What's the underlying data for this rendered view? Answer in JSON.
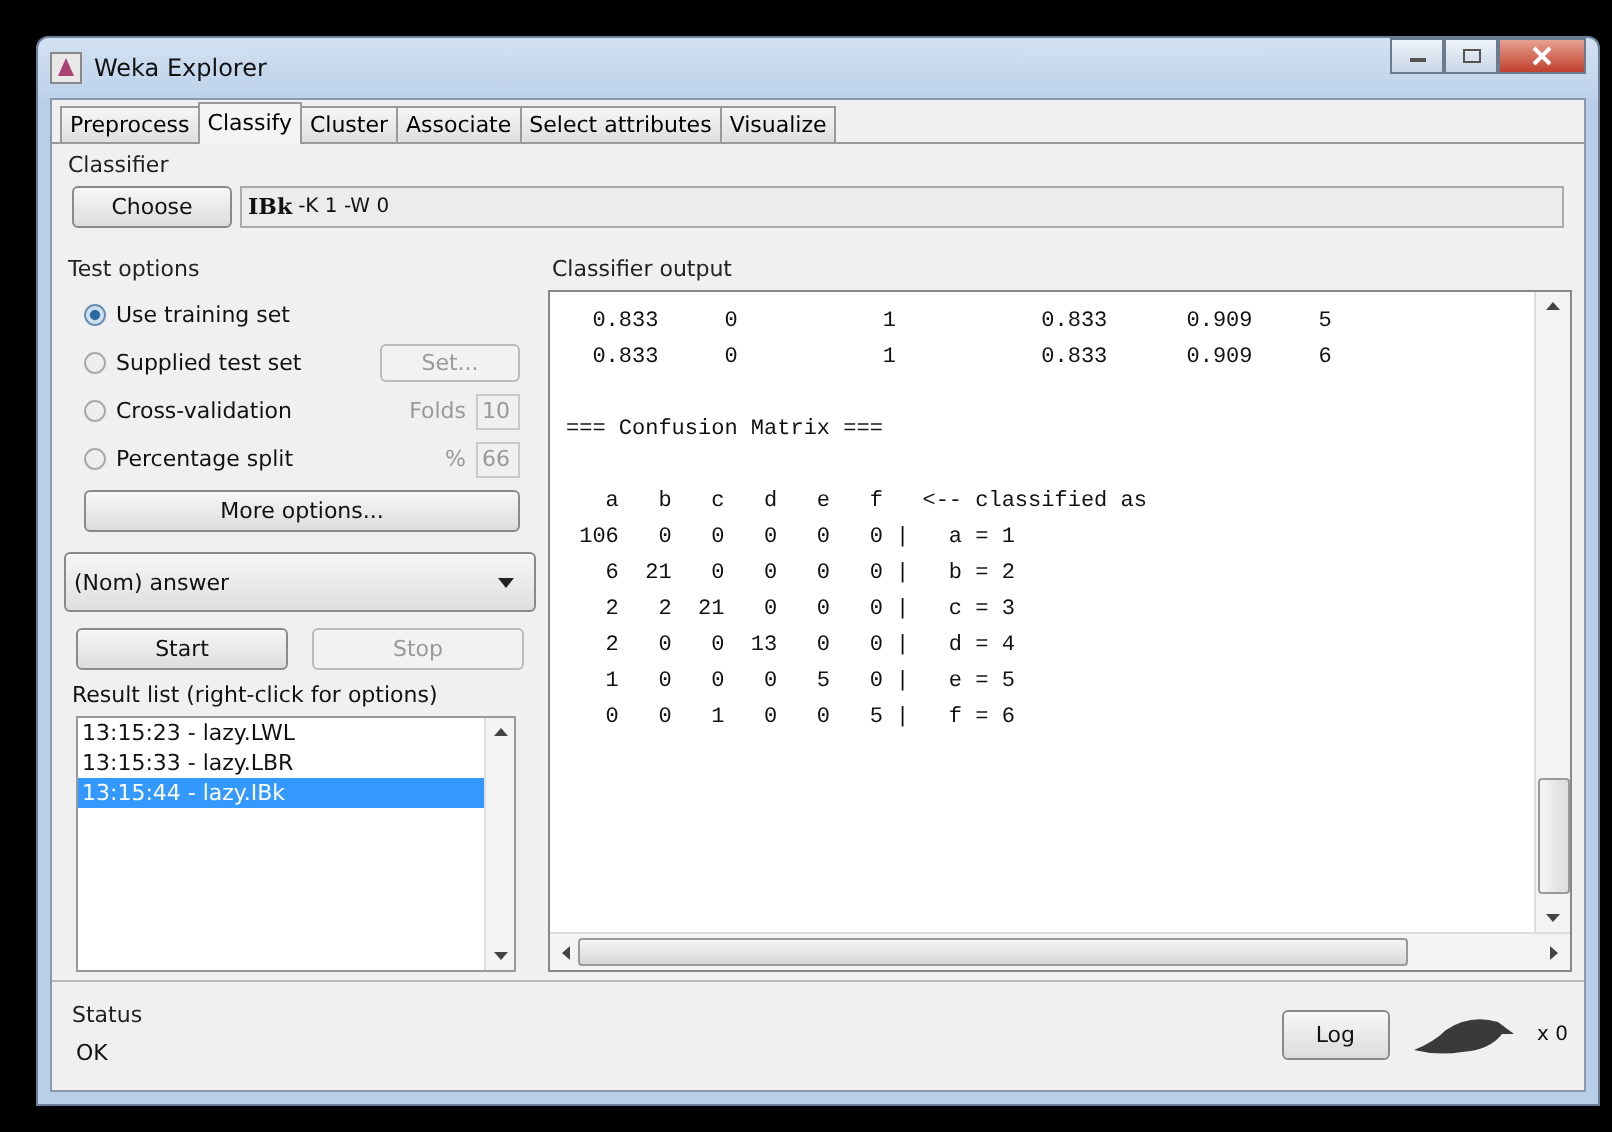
{
  "window": {
    "title": "Weka Explorer"
  },
  "tabs": [
    {
      "label": "Preprocess",
      "selected": false
    },
    {
      "label": "Classify",
      "selected": true
    },
    {
      "label": "Cluster",
      "selected": false
    },
    {
      "label": "Associate",
      "selected": false
    },
    {
      "label": "Select attributes",
      "selected": false
    },
    {
      "label": "Visualize",
      "selected": false
    }
  ],
  "classifier": {
    "title": "Classifier",
    "button": "Choose",
    "name": "IBk",
    "options": "-K 1 -W 0"
  },
  "test_options": {
    "title": "Test options",
    "options": [
      {
        "label": "Use training set",
        "selected": true
      },
      {
        "label": "Supplied test set",
        "selected": false,
        "kind": "button",
        "control": "Set...",
        "disabled": true
      },
      {
        "label": "Cross-validation",
        "selected": false,
        "kind": "field",
        "field_label": "Folds",
        "value": "10",
        "disabled": true
      },
      {
        "label": "Percentage split",
        "selected": false,
        "kind": "field",
        "field_label": "%",
        "value": "66",
        "disabled": true
      }
    ],
    "more_button": "More options..."
  },
  "class_select": {
    "value": "(Nom) answer"
  },
  "start_button": {
    "label": "Start",
    "disabled": false
  },
  "stop_button": {
    "label": "Stop",
    "disabled": true
  },
  "result_list": {
    "title": "Result list (right-click for options)",
    "items": [
      {
        "label": "13:15:23 - lazy.LWL",
        "selected": false
      },
      {
        "label": "13:15:33 - lazy.LBR",
        "selected": false
      },
      {
        "label": "13:15:44 - lazy.IBk",
        "selected": true
      }
    ]
  },
  "output": {
    "title": "Classifier output",
    "blocks": [
      {
        "lines": [
          "  0.833     0           1           0.833      0.909     5",
          "  0.833     0           1           0.833      0.909     6"
        ]
      },
      {
        "lines": [
          "=== Confusion Matrix ==="
        ]
      },
      {
        "lines": [
          "   a   b   c   d   e   f   <-- classified as",
          " 106   0   0   0   0   0 |   a = 1",
          "   6  21   0   0   0   0 |   b = 2",
          "   2   2  21   0   0   0 |   c = 3",
          "   2   0   0  13   0   0 |   d = 4",
          "   1   0   0   0   5   0 |   e = 5",
          "   0   0   1   0   0   5 |   f = 6"
        ]
      }
    ]
  },
  "status": {
    "title": "Status",
    "text": "OK",
    "log_button": "Log",
    "count": "x 0"
  }
}
